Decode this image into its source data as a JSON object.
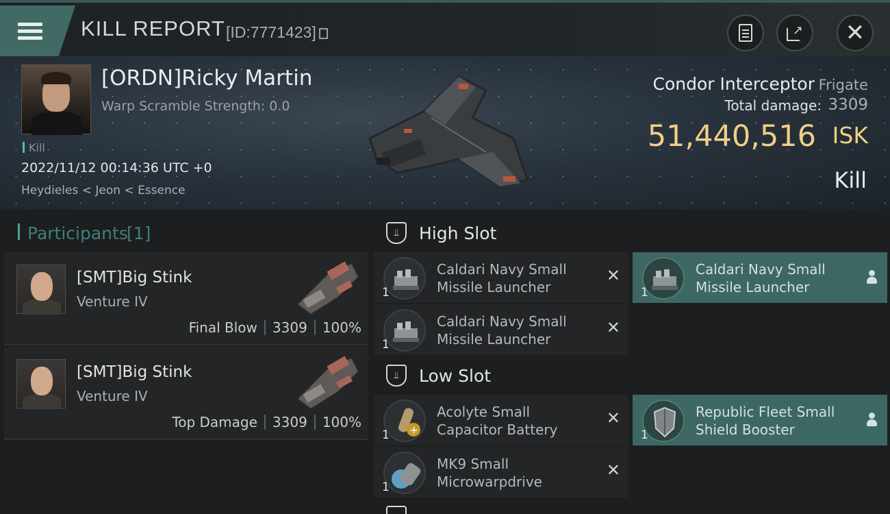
{
  "header": {
    "title": "KILL REPORT",
    "report_id": "[ID:7771423]"
  },
  "victim": {
    "name": "[ORDN]Ricky Martin",
    "warp_scramble": "Warp Scramble Strength: 0.0",
    "tag": "Kill",
    "datetime": "2022/11/12 00:14:36 UTC +0",
    "location": "Heydieles < Jeon < Essence",
    "ship_name": "Condor Interceptor",
    "ship_class": "Frigate",
    "total_damage_label": "Total damage:",
    "total_damage": "3309",
    "isk_value": "51,440,516",
    "isk_unit": "ISK",
    "result": "Kill"
  },
  "participants": {
    "title": "Participants",
    "count": "[1]",
    "rows": [
      {
        "name": "[SMT]Big Stink",
        "ship": "Venture IV",
        "role": "Final Blow",
        "damage": "3309",
        "percent": "100%"
      },
      {
        "name": "[SMT]Big Stink",
        "ship": "Venture IV",
        "role": "Top Damage",
        "damage": "3309",
        "percent": "100%"
      }
    ]
  },
  "slots": {
    "high": {
      "title": "High Slot",
      "items": [
        {
          "qty": "1",
          "line1": "Caldari Navy Small",
          "line2": "Missile Launcher",
          "status": "destroyed"
        },
        {
          "qty": "1",
          "line1": "Caldari Navy Small",
          "line2": "Missile Launcher",
          "status": "dropped"
        },
        {
          "qty": "1",
          "line1": "Caldari Navy Small",
          "line2": "Missile Launcher",
          "status": "destroyed"
        }
      ]
    },
    "low": {
      "title": "Low Slot",
      "items": [
        {
          "qty": "1",
          "line1": "Acolyte Small",
          "line2": "Capacitor Battery",
          "status": "destroyed"
        },
        {
          "qty": "1",
          "line1": "Republic Fleet Small",
          "line2": "Shield Booster",
          "status": "dropped"
        },
        {
          "qty": "1",
          "line1": "MK9 Small",
          "line2": "Microwarpdrive",
          "status": "destroyed"
        }
      ]
    }
  },
  "colors": {
    "accent": "#416a64",
    "isk": "#f0cf86",
    "dropped_bg": "#3d6762",
    "participants_title": "#3f7f7c"
  }
}
